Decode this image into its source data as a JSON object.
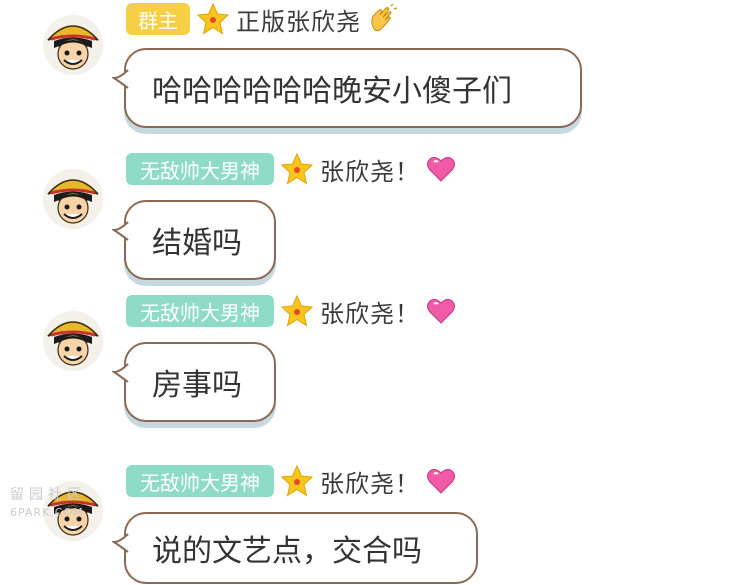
{
  "messages": [
    {
      "badge": "群主",
      "badge_style": "owner",
      "nickname": "正版张欣尧",
      "nick_emoji": "clapping-hands",
      "text": "哈哈哈哈哈哈晚安小傻子们"
    },
    {
      "badge": "无敌帅大男神",
      "badge_style": "title",
      "nickname": "张欣尧！",
      "nick_emoji": "pink-heart",
      "text": "结婚吗"
    },
    {
      "badge": "无敌帅大男神",
      "badge_style": "title",
      "nickname": "张欣尧！",
      "nick_emoji": "pink-heart",
      "text": "房事吗"
    },
    {
      "badge": "无敌帅大男神",
      "badge_style": "title",
      "nickname": "张欣尧！",
      "nick_emoji": "pink-heart",
      "text": "说的文艺点，交合吗"
    }
  ],
  "watermark": {
    "line1": "留园社区",
    "line2": "6PARK.COM"
  },
  "colors": {
    "owner_badge": "#f6cf45",
    "title_badge": "#8fdcc4",
    "bubble_border": "#8a6a55",
    "bubble_shadow": "#c8d8df",
    "star": "#f7c51e",
    "heart": "#f05aa6"
  },
  "avatar_icon": "straw-hat-cartoon-avatar",
  "star_icon": "star-badge-icon"
}
